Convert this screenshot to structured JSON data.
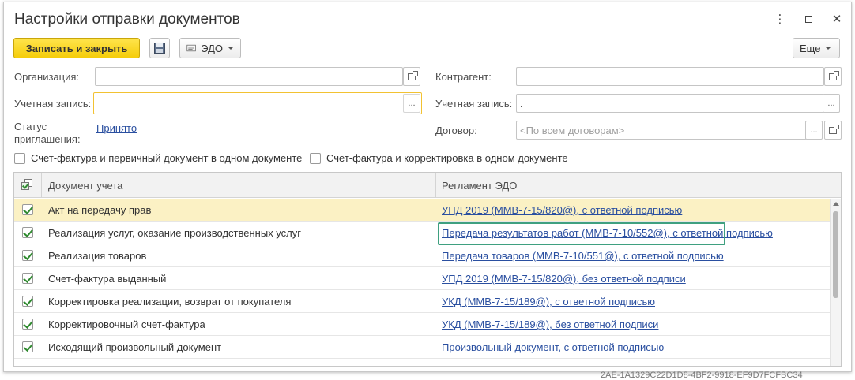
{
  "window": {
    "title": "Настройки отправки документов"
  },
  "toolbar": {
    "save_close": "Записать и закрыть",
    "edo": "ЭДО",
    "more": "Еще"
  },
  "form": {
    "org_label": "Организация:",
    "org_value": "",
    "account_label": "Учетная запись:",
    "account_value": "",
    "invite_status_label_1": "Статус",
    "invite_status_label_2": "приглашения:",
    "invite_status_value": "Принято",
    "counterparty_label": "Контрагент:",
    "counterparty_value": "",
    "cp_account_label": "Учетная запись:",
    "cp_account_value": ".",
    "contract_label": "Договор:",
    "contract_placeholder": "<По всем договорам>",
    "ellipsis": "..."
  },
  "checkboxes": {
    "combined_primary": "Счет-фактура и первичный документ в одном документе",
    "combined_correction": "Счет-фактура и корректировка в одном документе"
  },
  "table": {
    "col_doc": "Документ учета",
    "col_reg": "Регламент ЭДО",
    "rows": [
      {
        "doc": "Акт на передачу прав",
        "reg": "УПД 2019 (ММВ-7-15/820@), с ответной подписью",
        "checked": true
      },
      {
        "doc": "Реализация услуг, оказание производственных услуг",
        "reg": "Передача результатов работ (ММВ-7-10/552@), с ответной подписью",
        "checked": true
      },
      {
        "doc": "Реализация товаров",
        "reg": "Передача товаров (ММВ-7-10/551@), с ответной подписью",
        "checked": true
      },
      {
        "doc": "Счет-фактура выданный",
        "reg": "УПД 2019 (ММВ-7-15/820@), без ответной подписи",
        "checked": true
      },
      {
        "doc": "Корректировка реализации, возврат от покупателя",
        "reg": "УКД (ММВ-7-15/189@), с ответной подписью",
        "checked": true
      },
      {
        "doc": "Корректировочный счет-фактура",
        "reg": "УКД (ММВ-7-15/189@), без ответной подписи",
        "checked": true
      },
      {
        "doc": "Исходящий произвольный документ",
        "reg": "Произвольный документ, с ответной подписью",
        "checked": true
      }
    ]
  },
  "background_text": "2AE-1A1329C22D1D8-4BF2-9918-EF9D7FCFBC34"
}
